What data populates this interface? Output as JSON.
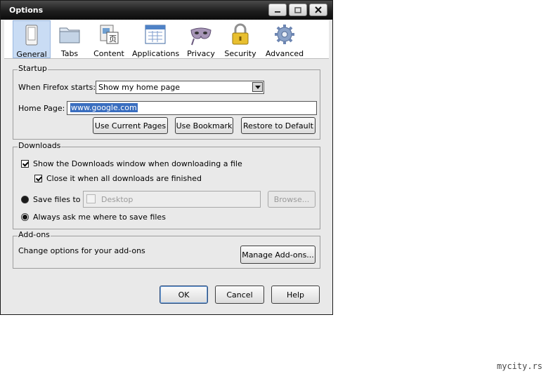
{
  "window": {
    "title": "Options"
  },
  "toolbar": {
    "tabs": [
      {
        "label": "General",
        "icon": "general-switch-icon",
        "selected": true
      },
      {
        "label": "Tabs",
        "icon": "tabs-folder-icon"
      },
      {
        "label": "Content",
        "icon": "content-page-icon"
      },
      {
        "label": "Applications",
        "icon": "applications-window-icon"
      },
      {
        "label": "Privacy",
        "icon": "privacy-mask-icon"
      },
      {
        "label": "Security",
        "icon": "security-lock-icon"
      },
      {
        "label": "Advanced",
        "icon": "advanced-gear-icon"
      }
    ]
  },
  "startup": {
    "legend": "Startup",
    "when_label": "When Firefox starts:",
    "when_value": "Show my home page",
    "home_label": "Home Page:",
    "home_value": "www.google.com",
    "btn_current": "Use Current Pages",
    "btn_bookmark": "Use Bookmark",
    "btn_restore": "Restore to Default"
  },
  "downloads": {
    "legend": "Downloads",
    "show_window": "Show the Downloads window when downloading a file",
    "close_when_done": "Close it when all downloads are finished",
    "save_files_to": "Save files to",
    "folder": "Desktop",
    "browse": "Browse...",
    "always_ask": "Always ask me where to save files"
  },
  "addons": {
    "legend": "Add-ons",
    "desc": "Change options for your add-ons",
    "manage": "Manage Add-ons..."
  },
  "footer": {
    "ok": "OK",
    "cancel": "Cancel",
    "help": "Help"
  },
  "watermark": "mycity.rs",
  "colors": {
    "titlebar": "#1e1e1e",
    "selection": "#3a6ebf",
    "selected_tab": "#c9dcf4"
  }
}
